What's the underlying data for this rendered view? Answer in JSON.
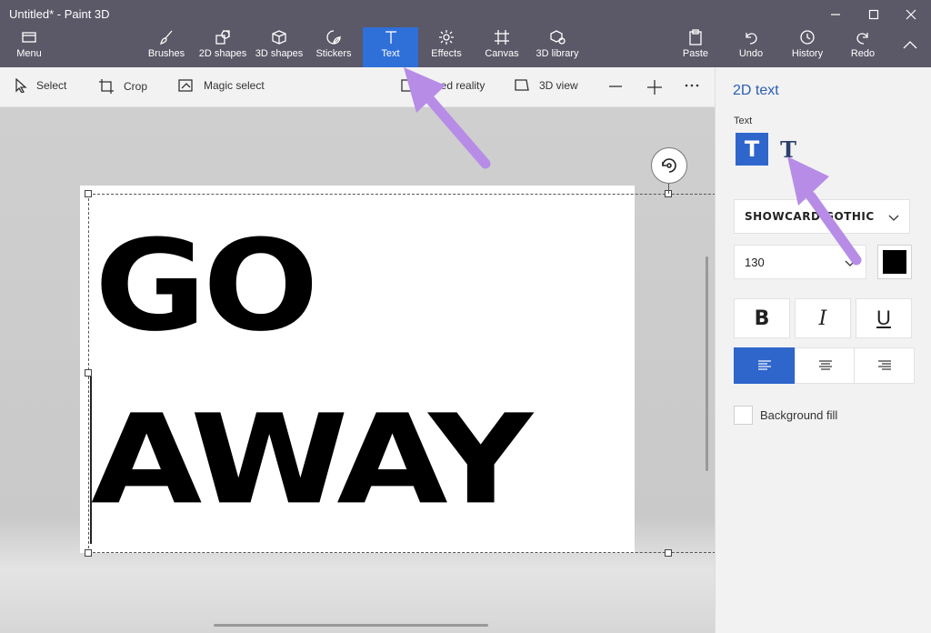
{
  "window": {
    "title": "Untitled* - Paint 3D"
  },
  "ribbon": {
    "menu": {
      "label": "Menu",
      "icon": "folder-icon"
    },
    "tools": [
      {
        "label": "Brushes",
        "icon": "brush-icon"
      },
      {
        "label": "2D shapes",
        "icon": "2d-shapes-icon"
      },
      {
        "label": "3D shapes",
        "icon": "cube-icon"
      },
      {
        "label": "Stickers",
        "icon": "sticker-icon"
      },
      {
        "label": "Text",
        "icon": "text-icon",
        "active": true
      },
      {
        "label": "Effects",
        "icon": "sun-icon"
      },
      {
        "label": "Canvas",
        "icon": "canvas-icon"
      },
      {
        "label": "3D library",
        "icon": "library-icon"
      }
    ],
    "actions": [
      {
        "label": "Paste",
        "icon": "clipboard-icon"
      },
      {
        "label": "Undo",
        "icon": "undo-icon"
      },
      {
        "label": "History",
        "icon": "history-icon"
      },
      {
        "label": "Redo",
        "icon": "redo-icon"
      }
    ]
  },
  "toolbar": {
    "select": "Select",
    "crop": "Crop",
    "magic_select": "Magic select",
    "mixed_reality": "Mixed reality",
    "view_3d": "3D view"
  },
  "canvas": {
    "line1": "GO",
    "line2": "AWAY"
  },
  "panel": {
    "title": "2D text",
    "text_label": "Text",
    "font_name": "SHOWCARD GOTHIC",
    "font_size": "130",
    "bold": "B",
    "italic": "I",
    "underline": "U",
    "background_fill": "Background fill",
    "text_color": "#000000"
  },
  "colors": {
    "accent": "#2f6fd8",
    "annotation_arrow": "#b78ce6"
  }
}
